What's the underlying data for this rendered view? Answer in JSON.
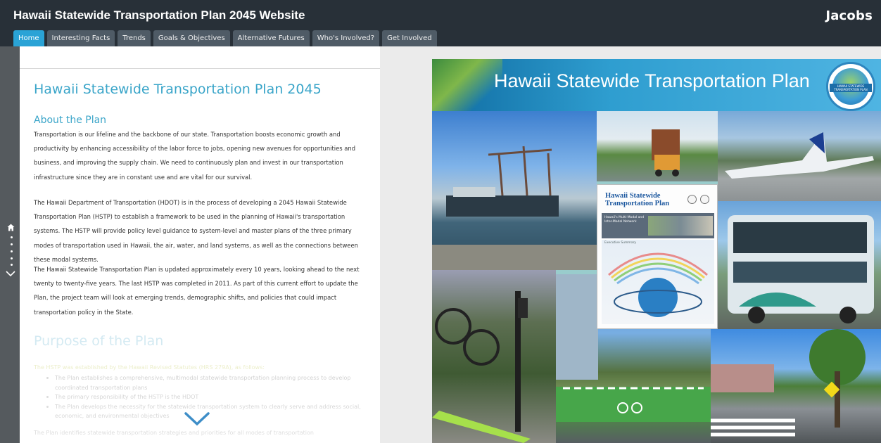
{
  "app": {
    "title": "Hawaii Statewide Transportation Plan 2045 Website",
    "brand": "Jacobs"
  },
  "tabs": [
    {
      "label": "Home",
      "active": true
    },
    {
      "label": "Interesting Facts",
      "active": false
    },
    {
      "label": "Trends",
      "active": false
    },
    {
      "label": "Goals & Objectives",
      "active": false
    },
    {
      "label": "Alternative Futures",
      "active": false
    },
    {
      "label": "Who's Involved?",
      "active": false
    },
    {
      "label": "Get Involved",
      "active": false
    }
  ],
  "rail": {
    "home_icon": "home-icon",
    "down_icon": "chevron-down-icon"
  },
  "panel": {
    "title": "Hawaii Statewide Transportation Plan 2045",
    "about_title": "About the Plan",
    "about_paragraphs": [
      "Transportation is our lifeline and the backbone of our state. Transportation boosts economic growth and productivity by enhancing accessibility of the labor force to jobs, opening new avenues for opportunities and business, and improving the supply chain. We need to continuously plan and invest in our transportation infrastructure since they are in constant use and are vital for our survival.",
      "The Hawaii Department of Transportation (HDOT) is in the process of developing a 2045 Hawaii Statewide Transportation Plan (HSTP) to establish a framework to be used in the planning of Hawaii's transportation systems. The HSTP will provide policy level guidance to system-level and master plans of the three primary modes of transportation used in Hawaii, the air, water, and land systems, as well as the connections between these modal systems.",
      "The Hawaii Statewide Transportation Plan is updated approximately every 10 years, looking ahead to the next twenty to twenty-five years. The last HSTP was completed in 2011. As part of this current effort to update the Plan, the project team will look at emerging trends, demographic shifts, and policies that could impact transportation policy in the State."
    ],
    "purpose_title": "Purpose of the Plan",
    "purpose_intro": "The HSTP was established by the Hawaii Revised Statutes (HRS 279A), as follows:",
    "purpose_bullets": [
      "The Plan establishes a comprehensive, multimodal statewide transportation planning process to develop coordinated transportation plans",
      "The primary responsibility of the HSTP is the HDOT",
      "The Plan develops the necessity for the statewide transportation system to clearly serve and address social, economic, and environmental objectives"
    ],
    "trailing_text": "The Plan identifies statewide transportation strategies and priorities for all modes of transportation",
    "scroll_icon": "chevron-down-icon"
  },
  "collage": {
    "banner_text": "Hawaii Statewide Transportation Plan",
    "seal_text": "HAWAII STATEWIDE TRANSPORTATION PLAN",
    "doc_title": "Hawaii Statewide Transportation Plan",
    "doc_subtitle": "Hawaii's Multi-Modal and Inter-Modal Network",
    "doc_section": "Executive Summary"
  },
  "colors": {
    "header_bg": "#283038",
    "tab_active": "#2aa3d6",
    "tab_inactive": "#4f5b66",
    "accent_title": "#3aa5c9",
    "rail_bg": "#555a5e"
  }
}
